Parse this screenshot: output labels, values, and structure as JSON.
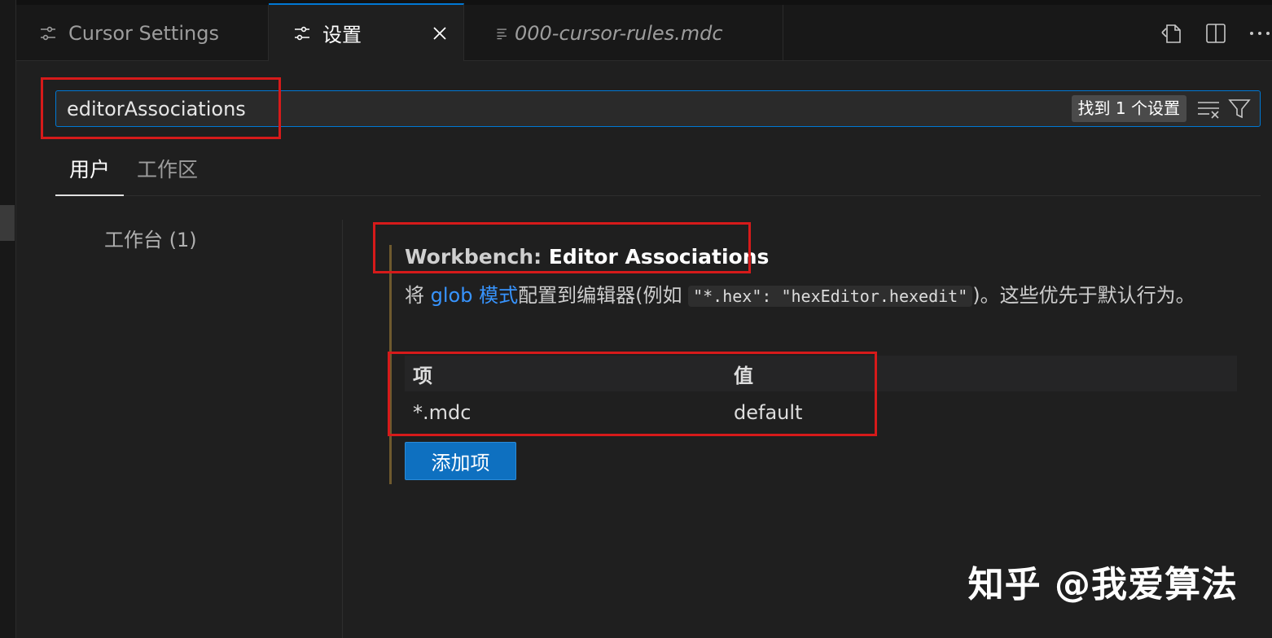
{
  "tabs": [
    {
      "label": "Cursor Settings",
      "icon": "settings-sliders-icon"
    },
    {
      "label": "设置",
      "icon": "settings-sliders-icon",
      "active": true
    },
    {
      "label": "000-cursor-rules.mdc",
      "icon": "markdown-file-icon"
    }
  ],
  "tab_actions": [
    "open-json-icon",
    "split-editor-icon",
    "more-actions-icon"
  ],
  "search": {
    "value": "editorAssociations",
    "result_count": "找到 1 个设置"
  },
  "scope_tabs": [
    "用户",
    "工作区"
  ],
  "toc": {
    "item": "工作台 (1)"
  },
  "setting": {
    "category": "Workbench: ",
    "name": "Editor Associations",
    "desc_prefix": "将 ",
    "desc_link": "glob 模式",
    "desc_mid": "配置到编辑器(例如 ",
    "desc_code": "\"*.hex\": \"hexEditor.hexedit\"",
    "desc_suffix": ")。这些优先于默认行为。"
  },
  "table": {
    "headers": [
      "项",
      "值"
    ],
    "rows": [
      [
        "*.mdc",
        "default"
      ]
    ]
  },
  "add_button": "添加项",
  "watermark": "知乎 @我爱算法",
  "colors": {
    "accent": "#0078d4",
    "highlight_box": "#d61a1a",
    "link": "#3794ff",
    "button": "#0e70c0"
  }
}
